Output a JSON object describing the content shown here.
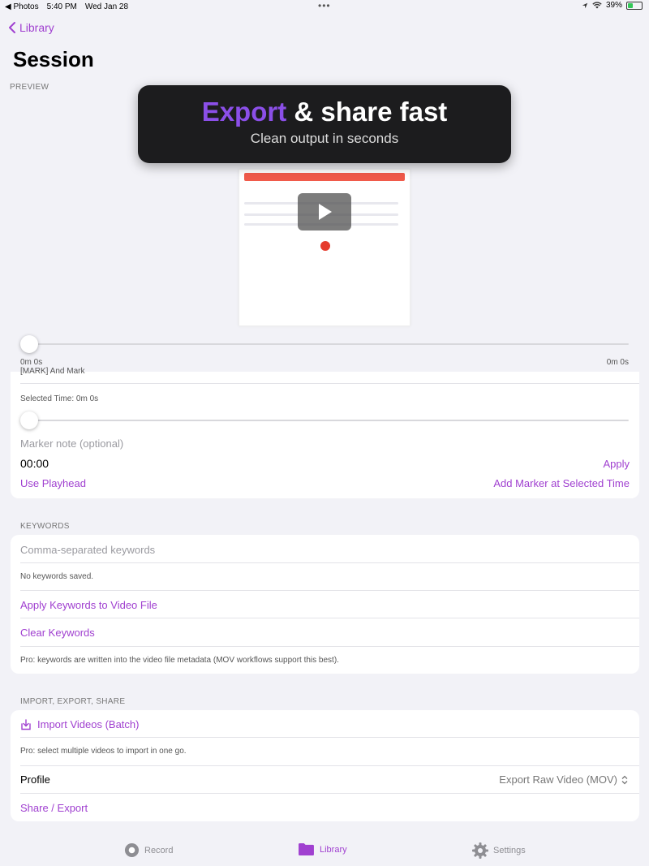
{
  "status_bar": {
    "back_app": "◀ Photos",
    "time": "5:40 PM",
    "date": "Wed Jan 28",
    "battery": "39%",
    "battery_level": 0.39
  },
  "nav": {
    "back_label": "Library",
    "title": "Session"
  },
  "preview": {
    "section_label": "PREVIEW",
    "banner_title_accent": "Export",
    "banner_title_rest": " & share fast",
    "banner_subtitle": "Clean output in seconds",
    "time_start": "0m 0s",
    "time_end": "0m 0s",
    "scrub_position": 0.0
  },
  "markers": {
    "partial_text": "[MARK] And Mark",
    "selected_time_label": "Selected Time: 0m 0s",
    "note_placeholder": "Marker note (optional)",
    "time_value": "00:00",
    "apply_label": "Apply",
    "use_playhead_label": "Use Playhead",
    "add_marker_label": "Add Marker at Selected Time"
  },
  "keywords": {
    "section_label": "KEYWORDS",
    "input_placeholder": "Comma-separated keywords",
    "empty_text": "No keywords saved.",
    "apply_label": "Apply Keywords to Video File",
    "clear_label": "Clear Keywords",
    "pro_note": "Pro: keywords are written into the video file metadata (MOV workflows support this best)."
  },
  "import_export": {
    "section_label": "IMPORT, EXPORT, SHARE",
    "import_label": "Import Videos (Batch)",
    "pro_note": "Pro: select multiple videos to import in one go.",
    "profile_label": "Profile",
    "profile_value": "Export Raw Video (MOV)",
    "share_label": "Share / Export"
  },
  "tabs": [
    {
      "label": "Record",
      "icon": "record-icon"
    },
    {
      "label": "Library",
      "icon": "folder-icon"
    },
    {
      "label": "Settings",
      "icon": "gear-icon"
    }
  ],
  "colors": {
    "accent": "#a040d0",
    "banner_accent": "#8b4fe8"
  }
}
